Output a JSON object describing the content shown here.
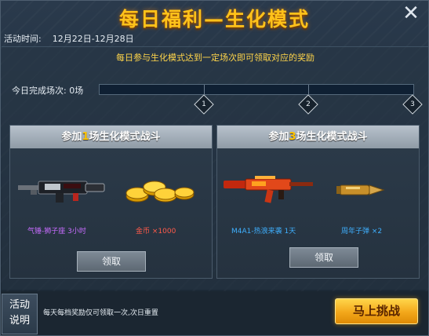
{
  "title": "每日福利—生化模式",
  "activity": {
    "label": "活动时间:",
    "date": "12月22日-12月28日"
  },
  "notice": "每日参与生化模式达到一定场次即可领取对应的奖励",
  "progress": {
    "label": "今日完成场次: 0场",
    "completed": 0,
    "milestones": [
      "1",
      "2",
      "3"
    ]
  },
  "cards": [
    {
      "header_prefix": "参加",
      "header_num": "1",
      "header_suffix": "场生化模式战斗",
      "items": [
        {
          "label": "气锤-狮子座 3小时",
          "color": "#c86cff",
          "icon": "gun-icon"
        },
        {
          "label": "金币  ×1000",
          "color": "#ff5a4a",
          "icon": "gold-coins-icon"
        }
      ],
      "button": "领取"
    },
    {
      "header_prefix": "参加",
      "header_num": "3",
      "header_suffix": "场生化模式战斗",
      "items": [
        {
          "label": "M4A1-热浪来袭 1天",
          "color": "#3fb0ff",
          "icon": "rifle-icon"
        },
        {
          "label": "周年子弹   ×2",
          "color": "#3fb0ff",
          "icon": "bullet-icon"
        }
      ],
      "button": "领取"
    }
  ],
  "footer": {
    "help_line1": "活动",
    "help_line2": "说明",
    "text": "每天每档奖励仅可领取一次,次日重置",
    "challenge": "马上挑战"
  },
  "close_icon": "close-icon",
  "colors": {
    "title": "#ffc21a",
    "accent": "#ffc400",
    "notice": "#ffd54a"
  }
}
